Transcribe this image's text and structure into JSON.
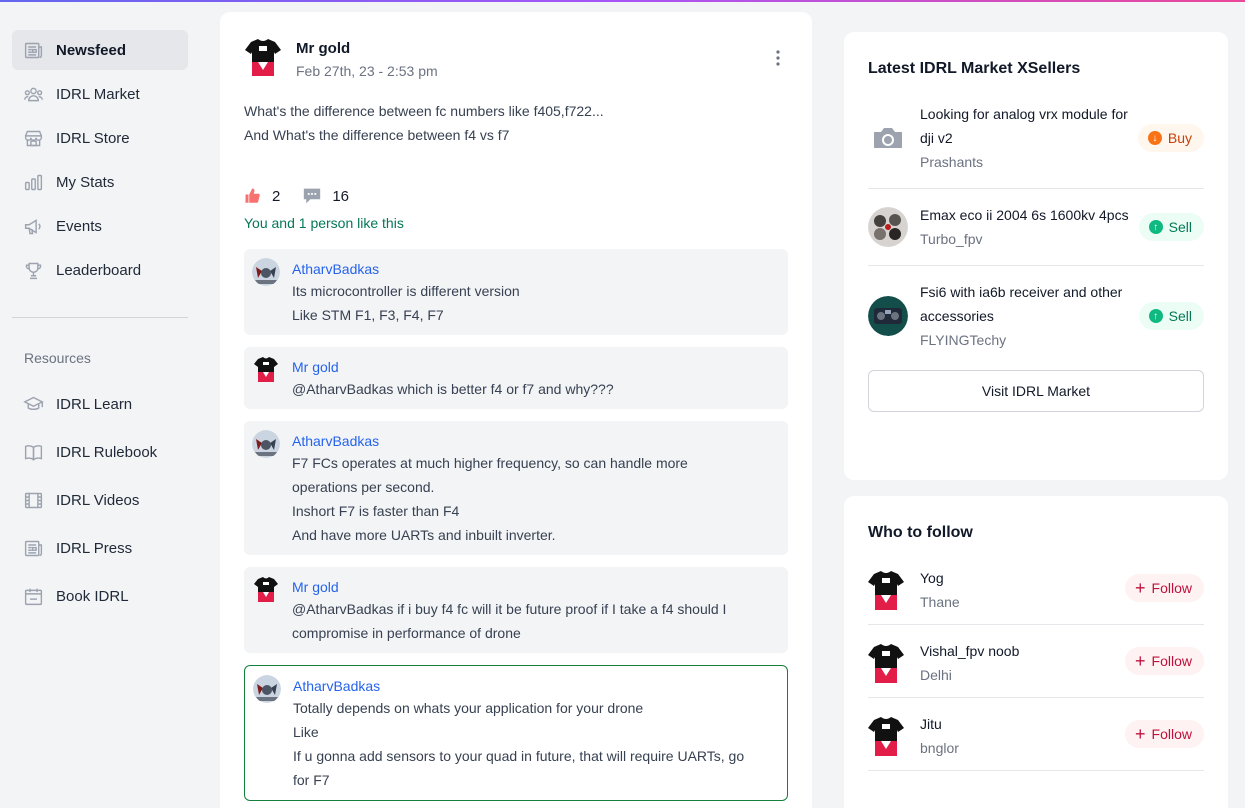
{
  "sidebar": {
    "items": [
      {
        "label": "Newsfeed",
        "icon": "newspaper-icon"
      },
      {
        "label": "IDRL Market",
        "icon": "users-icon"
      },
      {
        "label": "IDRL Store",
        "icon": "store-icon"
      },
      {
        "label": "My Stats",
        "icon": "bar-chart-icon"
      },
      {
        "label": "Events",
        "icon": "megaphone-icon"
      },
      {
        "label": "Leaderboard",
        "icon": "trophy-icon"
      }
    ],
    "resources_label": "Resources",
    "resources": [
      {
        "label": "IDRL Learn",
        "icon": "graduation-cap-icon"
      },
      {
        "label": "IDRL Rulebook",
        "icon": "book-open-icon"
      },
      {
        "label": "IDRL Videos",
        "icon": "film-icon"
      },
      {
        "label": "IDRL Press",
        "icon": "newspaper-icon"
      },
      {
        "label": "Book IDRL",
        "icon": "calendar-icon"
      }
    ]
  },
  "post": {
    "author": "Mr gold",
    "time": "Feb 27th, 23 - 2:53 pm",
    "body_line1": "What's the difference between fc numbers like f405,f722...",
    "body_line2": "And What's the difference between f4 vs f7",
    "likes": "2",
    "comments_count": "16",
    "likes_text": "You and 1 person like this"
  },
  "comments": [
    {
      "author": "AtharvBadkas",
      "lines": [
        "Its microcontroller is different version",
        "Like STM F1, F3, F4, F7"
      ]
    },
    {
      "author": "Mr gold",
      "lines": [
        "@AtharvBadkas which is better f4 or f7 and why???"
      ]
    },
    {
      "author": "AtharvBadkas",
      "lines": [
        "F7 FCs operates at much higher frequency, so can handle more",
        "operations per second.",
        "Inshort F7 is faster than F4",
        "And have more UARTs and inbuilt inverter."
      ]
    },
    {
      "author": "Mr gold",
      "lines": [
        "@AtharvBadkas if i buy f4 fc will it be future proof if I take a f4 should I",
        "compromise in performance of drone"
      ]
    },
    {
      "author": "AtharvBadkas",
      "lines": [
        "Totally depends on whats your application for your drone",
        "Like",
        "If u gonna add sensors to your quad in future, that will require UARTs, go",
        "for F7"
      ]
    }
  ],
  "market": {
    "title": "Latest IDRL Market XSellers",
    "items": [
      {
        "title": "Looking for analog vrx module for dji v2",
        "seller": "Prashants",
        "tag": "Buy"
      },
      {
        "title": "Emax eco ii 2004 6s 1600kv 4pcs",
        "seller": "Turbo_fpv",
        "tag": "Sell"
      },
      {
        "title": "Fsi6 with ia6b receiver and other accessories",
        "seller": "FLYINGTechy",
        "tag": "Sell"
      }
    ],
    "visit_label": "Visit IDRL Market"
  },
  "follow": {
    "title": "Who to follow",
    "button_label": "Follow",
    "people": [
      {
        "name": "Yog",
        "place": "Thane"
      },
      {
        "name": "Vishal_fpv noob",
        "place": "Delhi"
      },
      {
        "name": "Jitu",
        "place": "bnglor"
      }
    ]
  }
}
